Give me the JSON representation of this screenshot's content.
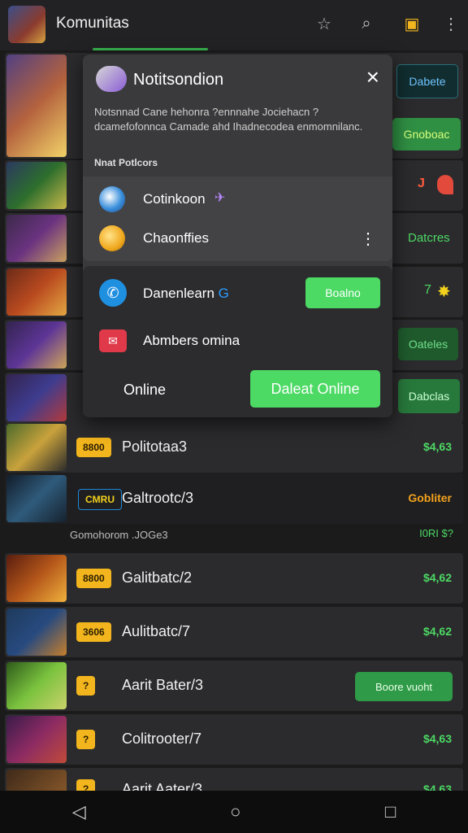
{
  "header": {
    "title": "Komunitas",
    "icons": [
      "star-icon",
      "search-icon",
      "message-icon",
      "more-vert-icon"
    ]
  },
  "side_buttons": {
    "b1": "Dabete",
    "b2": "Gnoboac",
    "b3": "J",
    "b4": "Datcres",
    "b5": "7",
    "b6": "Oateles",
    "b7": "Dabclas"
  },
  "popup": {
    "title": "Notitsondion",
    "description": "Notsnnad Cane hehonra ?ennnahe Jociehacn ? dcamefofonnca Camade ahd Ihadnecodea enmomnilanc.",
    "section_label": "Nnat Potlcors",
    "items": [
      {
        "label": "Cotinkoon"
      },
      {
        "label": "Chaonffies"
      }
    ],
    "lower": {
      "item1": "Danenlearn",
      "item1_button": "Boalno",
      "item2": "Abmbers omina",
      "online_label": "Online",
      "online_button": "Daleat Online"
    }
  },
  "list": {
    "rows": [
      {
        "badge": "8800",
        "title": "Politotaa3",
        "price": "$4,63"
      },
      {
        "badge": "CMRU",
        "title": "Galtrootc/3",
        "price": "Gobliter"
      },
      {
        "badge": "8800",
        "title": "Galitbatc/2",
        "price": "$4,62"
      },
      {
        "badge": "3606",
        "title": "Aulitbatc/7",
        "price": "$4,62"
      },
      {
        "badge": "?",
        "title": "Aarit Bater/3",
        "price": "Boore vuoht"
      },
      {
        "badge": "?",
        "title": "Colitrooter/7",
        "price": "$4,63"
      },
      {
        "badge": "?",
        "title": "Aarit Aater/3",
        "price": "$4,63"
      }
    ],
    "note": "Gomohorom .JOGe3",
    "note_price": "I0RI $?"
  },
  "navbar": {
    "back": "◁",
    "home": "○",
    "recents": "□"
  }
}
